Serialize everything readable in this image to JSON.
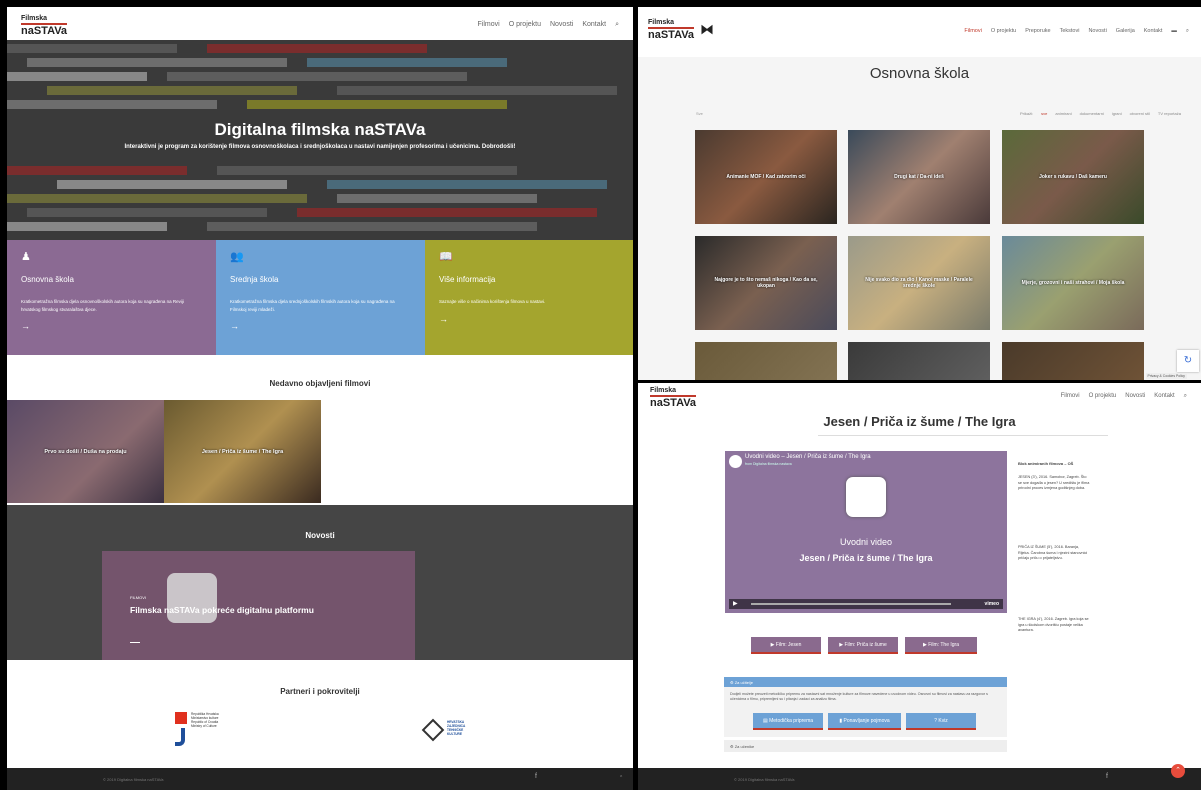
{
  "panel1": {
    "logo_top": "Filmska",
    "logo_bottom": "naSTAVa",
    "nav": [
      "Filmovi",
      "O projektu",
      "Novosti",
      "Kontakt"
    ],
    "hero_title": "Digitalna filmska naSTAVa",
    "hero_subtitle": "Interaktivni je program za korištenje filmova osnovnoškolaca i srednjoškolaca u nastavi namijenjen profesorima i učenicima. Dobrodošli!",
    "tiles": [
      {
        "title": "Osnovna škola",
        "desc": "Kratkometražna filmska djela osnovnoškolskih autora koja su nagrađena na Reviji hrvatskog filmskog stvaralaštva djece.",
        "color": "#8b6a93"
      },
      {
        "title": "Srednja škola",
        "desc": "Kratkometražna filmska djela srednjoškolskih filmskih autora koja su nagrađena na Filmskoj reviji mladeži.",
        "color": "#6da2d6"
      },
      {
        "title": "Više informacija",
        "desc": "Saznajte više o načinima korištenja filmova u nastavi.",
        "color": "#a4a52e"
      }
    ],
    "arrow": "→",
    "recent_title": "Nedavno objavljeni filmovi",
    "films": [
      "Prvo su došli / Duša na prodaju",
      "Jesen / Priča iz šume / The Igra"
    ],
    "news_title": "Novosti",
    "news_tag": "FILMOVI",
    "news_card_title": "Filmska naSTAVa pokreće digitalnu platformu",
    "partners_title": "Partneri i pokrovitelji",
    "partner1": "Republika Hrvatska Ministarstvo kulture Republic of Croatia Ministry of Culture",
    "partner2": "HRVATSKA ZAJEDNICA TEHNIČKE KULTURE",
    "footer": "© 2019 Digitalna filmska naSTAVa"
  },
  "panel2": {
    "logo_top": "Filmska",
    "logo_bottom": "naSTAVa",
    "nav": [
      "Filmovi",
      "O projektu",
      "Preporuke",
      "Tekstovi",
      "Novosti",
      "Galerija",
      "Kontakt"
    ],
    "page_title": "Osnovna škola",
    "filter_left": "Sve",
    "filters": [
      "Prikaži:",
      "sve",
      "animirani",
      "dokumentarni",
      "igrani",
      "otvoreni stil",
      "TV reportaža"
    ],
    "grid": [
      "Animanie MOF / Kad zatvorim oči",
      "Drugi kat / Da-ni ideš",
      "Joker s rukavu / Daš kameru",
      "Najgore je to što nemaš nikoga / Kao da se, ukopan",
      "Nije svako dio za dio / Kanoi maske / Paralele srednje škole",
      "Mjerje, grozovni i naši strahovi / Moja škola",
      "",
      "",
      ""
    ],
    "recaptcha": "Privacy & Cookies Policy"
  },
  "panel3": {
    "logo_top": "Filmska",
    "logo_bottom": "naSTAVa",
    "nav": [
      "Filmovi",
      "O projektu",
      "Novosti",
      "Kontakt"
    ],
    "page_title": "Jesen / Priča iz šume / The Igra",
    "video_header": "Uvodni video – Jesen / Priča iz šume / The Igra",
    "video_from": "from Digitalna filmska nastava",
    "video_caption1": "Uvodni video",
    "video_caption2": "Jesen / Priča iz šume / The Igra",
    "vimeo": "vimeo",
    "buttons": [
      "Film: Jesen",
      "Film: Priča iz šume",
      "Film: The Igra"
    ],
    "section1": "Za učitelje",
    "section_text": "Dodjeli možete preuzeti metodičku pripremu za nastavni sat množenje kulture za filmove navedene u uvodnom videu. Osnovni su filmovi za nastavu za razgovor s učenicima o filmu, pripremljeni su i pitanja i zadaci za analizu filma.",
    "actions": [
      "Metodička priprema",
      "Ponavljanje pojmova",
      "Kviz"
    ],
    "section2": "Za učenike",
    "sidebar_title": "Blok animiranih filmova – OŠ",
    "sidebar_items": [
      "JESEN (3'), 2016. Samobor, Zagreb. Što se sve događa u jesen? U središtu je filma prirodni proces izmjena godišnjeg doba.",
      "PRIČA IZ ŠUME (5'), 2016. Baranja, Rijeka. Čarobna šuma i njezini stanovnici pričaju priču o prijateljstvu.",
      "THE IGRA (4'), 2016. Zagreb. Igra koja se igra u školskom dvorištu postaje velika avantura."
    ],
    "footer": "© 2019 Digitalna filmska naSTAVa"
  }
}
